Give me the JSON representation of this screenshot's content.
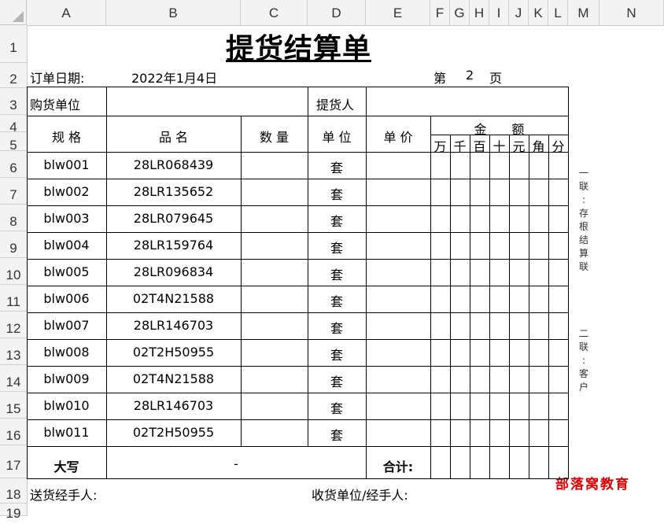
{
  "columns": [
    "A",
    "B",
    "C",
    "D",
    "E",
    "F",
    "G",
    "H",
    "I",
    "J",
    "K",
    "L",
    "M",
    "N"
  ],
  "rows": [
    "1",
    "2",
    "3",
    "4",
    "5",
    "6",
    "7",
    "8",
    "9",
    "10",
    "11",
    "12",
    "13",
    "14",
    "15",
    "16",
    "17",
    "18",
    "19"
  ],
  "form": {
    "title": "提货结算单",
    "order_date_label": "订单日期:",
    "order_date": "2022年1月4日",
    "page_prefix": "第",
    "page_number": "2",
    "page_suffix": "页",
    "buyer_label": "购货单位",
    "picker_label": "提货人",
    "headers": {
      "spec": "规 格",
      "name": "品 名",
      "qty": "数 量",
      "unit": "单 位",
      "price": "单 价",
      "amount": "金　　额",
      "digits": [
        "万",
        "千",
        "百",
        "十",
        "元",
        "角",
        "分"
      ]
    },
    "items": [
      {
        "spec": "blw001",
        "name": "28LR068439",
        "unit": "套"
      },
      {
        "spec": "blw002",
        "name": "28LR135652",
        "unit": "套"
      },
      {
        "spec": "blw003",
        "name": "28LR079645",
        "unit": "套"
      },
      {
        "spec": "blw004",
        "name": "28LR159764",
        "unit": "套"
      },
      {
        "spec": "blw005",
        "name": "28LR096834",
        "unit": "套"
      },
      {
        "spec": "blw006",
        "name": "02T4N21588",
        "unit": "套"
      },
      {
        "spec": "blw007",
        "name": "28LR146703",
        "unit": "套"
      },
      {
        "spec": "blw008",
        "name": "02T2H50955",
        "unit": "套"
      },
      {
        "spec": "blw009",
        "name": "02T4N21588",
        "unit": "套"
      },
      {
        "spec": "blw010",
        "name": "28LR146703",
        "unit": "套"
      },
      {
        "spec": "blw011",
        "name": "02T2H50955",
        "unit": "套"
      }
    ],
    "capital_label": "大写",
    "capital_value": "-",
    "total_label": "合计:",
    "sender_label": "送货经手人:",
    "receiver_label": "收货单位/经手人:",
    "side_note_1": [
      "一",
      "联",
      ":",
      "存",
      "根",
      "结",
      "算",
      "联"
    ],
    "side_note_2": [
      "二",
      "联",
      ":",
      "客",
      "户"
    ]
  },
  "watermark": "部落窝教育",
  "colors": {
    "watermark": "#e00000",
    "header_bg": "#f3f3f3"
  }
}
